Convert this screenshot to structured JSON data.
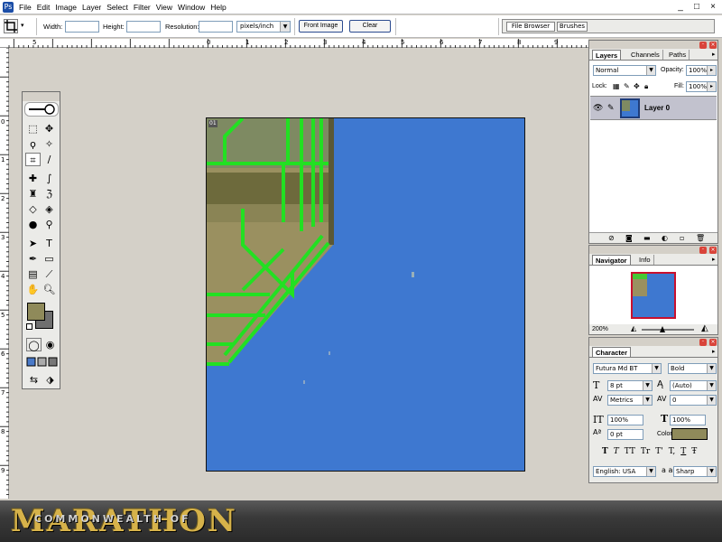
{
  "menubar": {
    "items": [
      "File",
      "Edit",
      "Image",
      "Layer",
      "Select",
      "Filter",
      "View",
      "Window",
      "Help"
    ],
    "window_controls": [
      "_",
      "□",
      "×"
    ]
  },
  "options_bar": {
    "tool_icon": "crop-icon",
    "width_label": "Width:",
    "width_value": "",
    "height_label": "Height:",
    "height_value": "",
    "resolution_label": "Resolution:",
    "resolution_value": "",
    "units_value": "pixels/inch",
    "front_image_label": "Front Image",
    "clear_label": "Clear"
  },
  "palette_well": {
    "tabs": [
      "File Browser",
      "Brushes"
    ]
  },
  "rulers": {
    "top": [
      "5",
      "0",
      "1",
      "2",
      "3",
      "4",
      "5",
      "6",
      "7",
      "8",
      "9",
      "10",
      "11",
      "12",
      "13",
      "14"
    ],
    "left": [
      "0",
      "1",
      "2",
      "3",
      "4",
      "5",
      "6",
      "7",
      "8",
      "9"
    ]
  },
  "document": {
    "tag": "01",
    "background_color": "#3e78d0",
    "overlay_color": "#9a9060",
    "outline_color": "#22e022"
  },
  "layers_panel": {
    "tabs": [
      "Layers",
      "Channels",
      "Paths"
    ],
    "blend_mode": "Normal",
    "opacity_label": "Opacity:",
    "opacity_value": "100%",
    "lock_label": "Lock:",
    "fill_label": "Fill:",
    "fill_value": "100%",
    "layer_name": "Layer 0"
  },
  "navigator_panel": {
    "tabs": [
      "Navigator",
      "Info"
    ],
    "zoom_value": "200%"
  },
  "character_panel": {
    "tab": "Character",
    "font_family": "Futura Md BT",
    "font_style": "Bold",
    "font_size": "8 pt",
    "leading": "(Auto)",
    "kerning": "Metrics",
    "tracking": "0",
    "vertical_scale": "100%",
    "horizontal_scale": "100%",
    "baseline_shift": "0 pt",
    "color_label": "Color:",
    "color_value": "#8f8a5a",
    "language": "English: USA",
    "antialias_prefix": "a a",
    "antialias": "Sharp",
    "style_buttons": [
      "T",
      "T",
      "TT",
      "Tr",
      "T'",
      "T,",
      "T",
      "Ŧ"
    ]
  },
  "banner": {
    "title": "MARATHON",
    "subtitle": "COMMONWEALTH OF"
  }
}
